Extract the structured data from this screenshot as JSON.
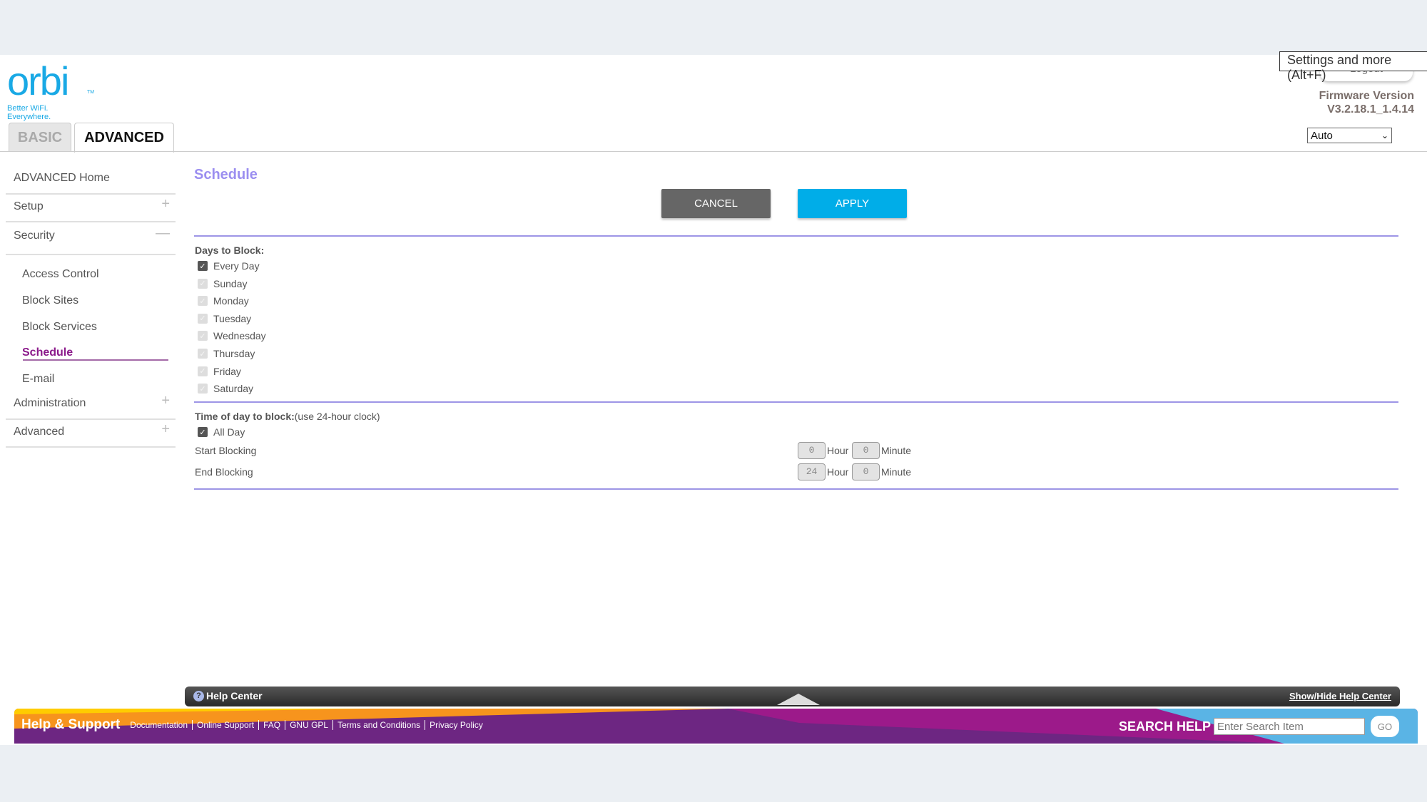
{
  "header": {
    "logo_text": "orbi",
    "logo_tagline": "Better WiFi. Everywhere.",
    "tabs": [
      {
        "label": "BASIC",
        "active": false
      },
      {
        "label": "ADVANCED",
        "active": true
      }
    ],
    "browser_tooltip": "Settings and more (Alt+F)",
    "logout_label": "Logout",
    "firmware_label": "Firmware Version",
    "firmware_version": "V3.2.18.1_1.4.14",
    "language_select": "Auto"
  },
  "sidebar": {
    "home": "ADVANCED Home",
    "setup": "Setup",
    "security": "Security",
    "security_items": [
      "Access Control",
      "Block Sites",
      "Block Services",
      "Schedule",
      "E-mail"
    ],
    "active_item": "Schedule",
    "administration": "Administration",
    "advanced": "Advanced"
  },
  "main": {
    "title": "Schedule",
    "cancel_label": "CANCEL",
    "apply_label": "APPLY",
    "days_heading": "Days to Block:",
    "days": [
      {
        "label": "Every Day",
        "checked": true,
        "disabled": false
      },
      {
        "label": "Sunday",
        "checked": true,
        "disabled": true
      },
      {
        "label": "Monday",
        "checked": true,
        "disabled": true
      },
      {
        "label": "Tuesday",
        "checked": true,
        "disabled": true
      },
      {
        "label": "Wednesday",
        "checked": true,
        "disabled": true
      },
      {
        "label": "Thursday",
        "checked": true,
        "disabled": true
      },
      {
        "label": "Friday",
        "checked": true,
        "disabled": true
      },
      {
        "label": "Saturday",
        "checked": true,
        "disabled": true
      }
    ],
    "time_heading": "Time of day to block:",
    "time_note": "(use 24-hour clock)",
    "all_day_label": "All Day",
    "start_label": "Start Blocking",
    "end_label": "End Blocking",
    "start_hour": "0",
    "start_minute": "0",
    "end_hour": "24",
    "end_minute": "0",
    "hour_unit": "Hour",
    "minute_unit": "Minute"
  },
  "help": {
    "help_center": "Help Center",
    "show_hide": "Show/Hide Help Center",
    "support_title": "Help & Support",
    "links": [
      "Documentation",
      "Online Support",
      "FAQ",
      "GNU GPL",
      "Terms and Conditions",
      "Privacy Policy"
    ],
    "search_label": "SEARCH HELP",
    "search_placeholder": "Enter Search Item",
    "go_label": "GO"
  },
  "colors": {
    "brand": "#19a9e5",
    "accent": "#9b8ef0",
    "apply": "#00ade8",
    "footer": "#6d2682"
  }
}
